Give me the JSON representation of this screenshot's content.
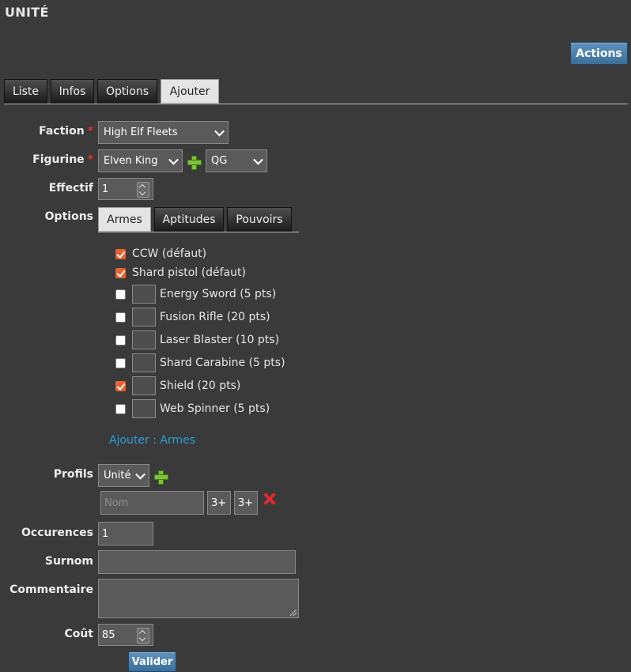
{
  "page": {
    "title": "UNITÉ"
  },
  "actions_label": "Actions",
  "tabs": [
    {
      "label": "Liste"
    },
    {
      "label": "Infos"
    },
    {
      "label": "Options"
    },
    {
      "label": "Ajouter",
      "active": true
    }
  ],
  "form": {
    "faction": {
      "label": "Faction",
      "required_mark": "*",
      "value": "High Elf Fleets"
    },
    "figurine": {
      "label": "Figurine",
      "required_mark": "*",
      "value": "Elven King",
      "type_value": "QG"
    },
    "effectif": {
      "label": "Effectif",
      "value": "1"
    },
    "options": {
      "label": "Options",
      "tabs": [
        {
          "label": "Armes",
          "active": true
        },
        {
          "label": "Aptitudes"
        },
        {
          "label": "Pouvoirs"
        }
      ],
      "default_items": [
        {
          "label": "CCW (défaut)",
          "checked": true
        },
        {
          "label": "Shard pistol (défaut)",
          "checked": true
        }
      ],
      "items": [
        {
          "label": "Energy Sword (5 pts)",
          "checked": false
        },
        {
          "label": "Fusion Rifle (20 pts)",
          "checked": false
        },
        {
          "label": "Laser Blaster (10 pts)",
          "checked": false
        },
        {
          "label": "Shard Carabine (5 pts)",
          "checked": false
        },
        {
          "label": "Shield (20 pts)",
          "checked": true
        },
        {
          "label": "Web Spinner (5 pts)",
          "checked": false
        }
      ],
      "add_link": "Ajouter : Armes"
    },
    "profils": {
      "label": "Profils",
      "select_value": "Unité",
      "name_placeholder": "Nom",
      "stat1": "3+",
      "stat2": "3+"
    },
    "occurences": {
      "label": "Occurences",
      "value": "1"
    },
    "surnom": {
      "label": "Surnom",
      "value": ""
    },
    "commentaire": {
      "label": "Commentaire",
      "value": ""
    },
    "cout": {
      "label": "Coût",
      "value": "85"
    },
    "submit_label": "Valider"
  },
  "colors": {
    "accent_blue": "#3a6f99",
    "checkbox_orange": "#e8622f",
    "link_blue": "#2a9fd6",
    "required_red": "#e03030"
  }
}
